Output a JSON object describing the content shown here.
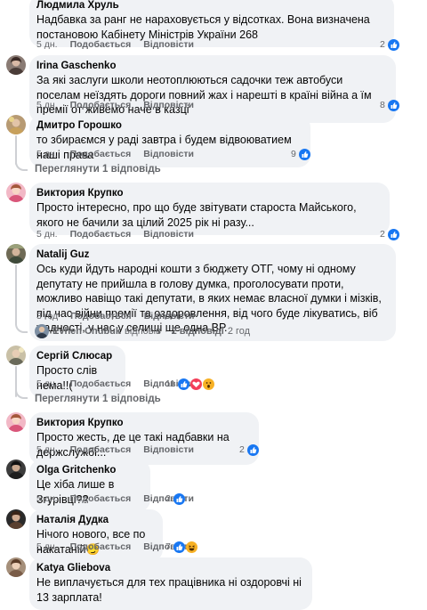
{
  "comments": [
    {
      "author": "Людмила Хруль",
      "text": "Надбавка за ранг не нараховується у відсотках. Вона визначена постановою Кабінету Міністрів України 268",
      "time": "5 дн.",
      "like": "Подобається",
      "reply": "Відповісти",
      "reaction_count": "2"
    },
    {
      "author": "Irina Gaschenko",
      "text": "За які заслуги школи неотоплюються садочки теж автобуси поселам неїздять дороги повний жах і нарешті в країні війна а їм премії от живемо наче в казці",
      "time": "5 дн.",
      "like": "Подобається",
      "reply": "Відповісти",
      "reaction_count": "8"
    },
    {
      "author": "Дмитро Горошко",
      "text": "то збираємся у раді завтра і будем відвоюватием наші права",
      "time": "5 дн.",
      "like": "Подобається",
      "reply": "Відповісти",
      "reaction_count": "9",
      "replies_link": "Переглянути 1 відповідь"
    },
    {
      "author": "Виктория Крупко",
      "text": "Просто інтересно, про що буде звітувати староста Майського, якого не бачили за цілий 2025 рік ні разу...",
      "time": "5 дн.",
      "like": "Подобається",
      "reply": "Відповісти",
      "reaction_count": "2"
    },
    {
      "author": "Natalij Guz",
      "text": "Ось куди йдуть народні кошти з бюджету ОТГ, чому ні одному депутату не прийшла в голову думка, проголосувати проти, можливо навіщо такі депутати, в яких немає власної думки і мізків, під час війни премії та оздоровлення, від чого буде лікуватись, віб жадності, у нас у селищі ще одна ВР.",
      "time": "3 год",
      "like": "Подобається",
      "reply": "Відповісти",
      "reply_preview": {
        "name": "Evhen Chubuk",
        "action": "відповів",
        "sep": "·",
        "count": "2 відповіді",
        "time": "2 год"
      }
    },
    {
      "author": "Сергій Слюсар",
      "text": "Просто слів нема!!(",
      "time": "5 дн.",
      "like": "Подобається",
      "reply": "Відповісти",
      "reaction_count": "11",
      "replies_link": "Переглянути 1 відповідь"
    },
    {
      "author": "Виктория Крупко",
      "text": "Просто жесть, де це такі надбавки на держслужбі...",
      "time": "5 дн.",
      "like": "Подобається",
      "reply": "Відповісти",
      "reaction_count": "2"
    },
    {
      "author": "Olga Gritchenko",
      "text": "Це хіба лише в Згурівці??",
      "time": "5 дн.",
      "like": "Подобається",
      "reply": "Відповісти",
      "reaction_count": "2"
    },
    {
      "author": "Наталія Дудка",
      "text": "Нічого нового, все по накатаній😏",
      "time": "5 дн.",
      "like": "Подобається",
      "reply": "Відповісти",
      "reaction_count": "7"
    },
    {
      "author": "Katya Gliebova",
      "text": "Не виплачується для тех працівника ні оздоровчі ні 13 зарплата!",
      "time": "",
      "like": "",
      "reply": ""
    }
  ],
  "colors": {
    "like_blue": "#1877f2",
    "love_red": "#f33e58",
    "haha_yellow": "#f7b125",
    "bubble_bg": "#f0f2f5",
    "meta_gray": "#65676b"
  },
  "icons": {
    "like": "like-reaction-icon",
    "love": "love-reaction-icon",
    "wow": "wow-reaction-icon",
    "haha": "haha-reaction-icon",
    "reply_arrow": "reply-arrow-icon"
  }
}
